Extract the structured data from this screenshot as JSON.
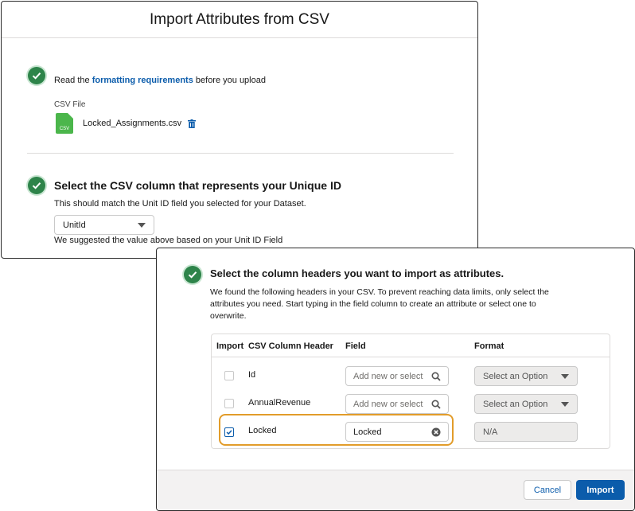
{
  "upload_modal": {
    "title": "Import Attributes from CSV",
    "step1": {
      "text_before": "Read the ",
      "link": "formatting requirements",
      "text_after": " before you upload",
      "file_label": "CSV File",
      "file_icon_text": "CSV",
      "file_name": "Locked_Assignments.csv"
    },
    "step2": {
      "heading": "Select the CSV column that represents your Unique ID",
      "description": "This should match the Unit ID field you selected for your Dataset.",
      "selected_value": "UnitId",
      "hint": "We suggested the value above based on your Unit ID Field"
    }
  },
  "attributes_modal": {
    "heading": "Select the column headers you want to import as attributes.",
    "description_line1": "We found the following headers in your CSV. To prevent reaching data limits, only select the",
    "description_line2": "attributes you need. Start typing in the field column to create an attribute or select one to",
    "description_line3": "overwrite.",
    "columns": {
      "import": "Import",
      "header": "CSV Column Header",
      "field": "Field",
      "format": "Format"
    },
    "rows": [
      {
        "checked": false,
        "header": "Id",
        "field_placeholder": "Add new or select",
        "field_value": "",
        "format": "Select an Option"
      },
      {
        "checked": false,
        "header": "AnnualRevenue",
        "field_placeholder": "Add new or select",
        "field_value": "",
        "format": "Select an Option"
      },
      {
        "checked": true,
        "header": "Locked",
        "field_placeholder": "",
        "field_value": "Locked",
        "format": "N/A"
      }
    ],
    "cancel_label": "Cancel",
    "import_label": "Import"
  },
  "colors": {
    "success_green": "#2e844a",
    "brand_blue": "#0b5cab",
    "highlight_orange": "#e29c2a"
  }
}
